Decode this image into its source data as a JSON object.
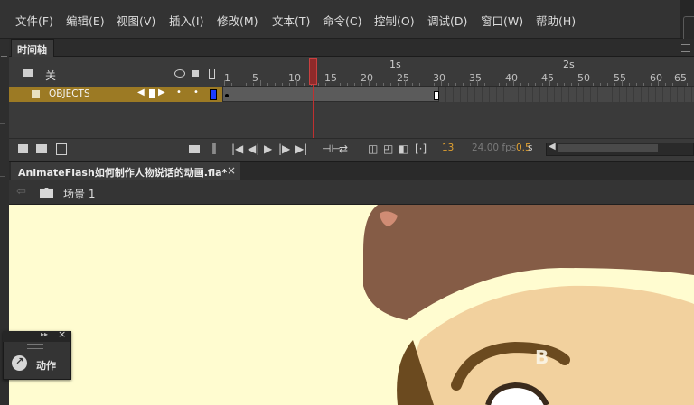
{
  "menu": [
    "文件(F)",
    "编辑(E)",
    "视图(V)",
    "插入(I)",
    "修改(M)",
    "文本(T)",
    "命令(C)",
    "控制(O)",
    "调试(D)",
    "窗口(W)",
    "帮助(H)"
  ],
  "timeline": {
    "tab_label": "时间轴",
    "header_label": "关",
    "layer_name": "OBJECTS",
    "ruler_frames": [
      "1",
      "5",
      "10",
      "15",
      "20",
      "25",
      "30",
      "35",
      "40",
      "45",
      "50",
      "55",
      "60",
      "65"
    ],
    "ruler_seconds": [
      "1s",
      "2s"
    ],
    "current_frame": "13",
    "fps": "24.00 fps",
    "elapsed_value": "0.5",
    "elapsed_unit": "s",
    "colors": {
      "layer_highlight": "#9c7a24",
      "playhead": "#c03030",
      "accent_text": "#e0a030"
    }
  },
  "document": {
    "tab_title": "AnimateFlash如何制作人物说话的动画.fla*",
    "close_glyph": "×",
    "scene_label": "场景 1"
  },
  "actions_panel": {
    "label": "动作",
    "collapse_glyph": "▸▸",
    "close_glyph": "×"
  },
  "stage": {
    "background": "#fffcd0",
    "icons": [
      "character-hair",
      "character-face",
      "character-eyebrow",
      "character-eye"
    ]
  }
}
